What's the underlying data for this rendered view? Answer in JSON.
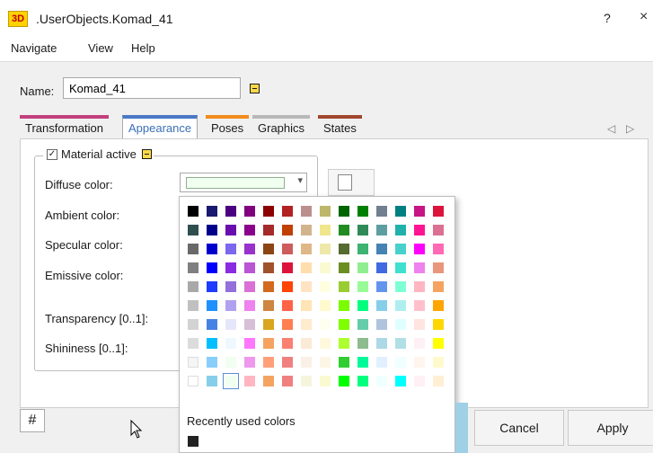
{
  "window": {
    "icon_text": "3D",
    "title": ".UserObjects.Komad_41",
    "help_label": "?",
    "close_label": "×"
  },
  "menu": [
    "Navigate",
    "View",
    "Help"
  ],
  "name": {
    "label": "Name:",
    "value": "Komad_41"
  },
  "tabs": [
    {
      "label": "Transformation",
      "color": "#c2407d"
    },
    {
      "label": "Appearance",
      "color": "#4a78c4",
      "active": true
    },
    {
      "label": "Poses",
      "color": "#f08c1c"
    },
    {
      "label": "Graphics",
      "color": "#b8b8b8"
    },
    {
      "label": "States",
      "color": "#a1472e"
    }
  ],
  "tab_nav": {
    "left_icon": "caret-left-icon",
    "right_icon": "caret-right-icon"
  },
  "material": {
    "active_label": "Material active",
    "checked": true,
    "fields": [
      "Diffuse color:",
      "Ambient color:",
      "Specular color:",
      "Emissive color:",
      "Transparency [0..1]:",
      "Shininess [0..1]:"
    ],
    "diffuse_value_color": "#f0fff0"
  },
  "color_popup": {
    "palette": [
      [
        "#000000",
        "#191970",
        "#4b0082",
        "#800080",
        "#8b0000",
        "#b22222",
        "#bc8f8f",
        "#bdb76b",
        "#006400",
        "#008000",
        "#708090",
        "#008080",
        "#c71585",
        "#dc143c"
      ],
      [
        "#2f4f4f",
        "#00008b",
        "#6a0dad",
        "#8b008b",
        "#a52a2a",
        "#c04000",
        "#d2b48c",
        "#f0e68c",
        "#228b22",
        "#2e8b57",
        "#5f9ea0",
        "#20b2aa",
        "#ff1493",
        "#db7093"
      ],
      [
        "#696969",
        "#0000cd",
        "#7b68ee",
        "#9932cc",
        "#8b4513",
        "#cd5c5c",
        "#deb887",
        "#eee8aa",
        "#556b2f",
        "#3cb371",
        "#4682b4",
        "#48d1cc",
        "#ff00ff",
        "#ff69b4"
      ],
      [
        "#808080",
        "#0000ff",
        "#8a2be2",
        "#ba55d3",
        "#a0522d",
        "#dc143c",
        "#ffdead",
        "#fafad2",
        "#6b8e23",
        "#90ee90",
        "#4169e1",
        "#40e0d0",
        "#ee82ee",
        "#e9967a"
      ],
      [
        "#a9a9a9",
        "#1e3cff",
        "#9370db",
        "#da70d6",
        "#d2691e",
        "#ff4500",
        "#ffe4c4",
        "#ffffe0",
        "#9acd32",
        "#98fb98",
        "#6495ed",
        "#7fffd4",
        "#ffb6c1",
        "#f4a460"
      ],
      [
        "#c0c0c0",
        "#1e90ff",
        "#b0a0f0",
        "#ee82ee",
        "#cd853f",
        "#ff6347",
        "#ffe4b5",
        "#fffacd",
        "#7cfc00",
        "#00ff7f",
        "#87ceeb",
        "#afeeee",
        "#ffc0cb",
        "#ffa500"
      ],
      [
        "#d3d3d3",
        "#4682e4",
        "#e6e6fa",
        "#d8bfd8",
        "#daa520",
        "#ff7f50",
        "#ffebcd",
        "#fffff0",
        "#7fff00",
        "#66cdaa",
        "#b0c4de",
        "#e0ffff",
        "#ffe4e1",
        "#ffd700"
      ],
      [
        "#dcdcdc",
        "#00bfff",
        "#f0f8ff",
        "#ff77ff",
        "#f4a460",
        "#fa8072",
        "#faebd7",
        "#fff8dc",
        "#adff2f",
        "#8fbc8f",
        "#add8e6",
        "#b0e0e6",
        "#fff0f5",
        "#ffff00"
      ],
      [
        "#f5f5f5",
        "#87cefa",
        "#f0fff0",
        "#ee99ee",
        "#ffa07a",
        "#f08080",
        "#faf0e6",
        "#fdf5e6",
        "#32cd32",
        "#00fa9a",
        "#e0f0ff",
        "#f0ffff",
        "#fff5ee",
        "#fffacd"
      ],
      [
        "#ffffff",
        "#87ceeb",
        "#f0fff0",
        "#ffb6c1",
        "#f4a460",
        "#f08080",
        "#f5f5dc",
        "#fafad2",
        "#00ff00",
        "#00ff7f",
        "#f0ffff",
        "#00ffff",
        "#fff0f5",
        "#ffefd5"
      ]
    ],
    "selected_row": 9,
    "selected_col": 2,
    "recent_label": "Recently used colors",
    "recent_colors": [
      "#222222"
    ]
  },
  "buttons": {
    "grid_icon": "hash-icon",
    "grid_symbol": "#",
    "cancel": "Cancel",
    "apply": "Apply"
  }
}
